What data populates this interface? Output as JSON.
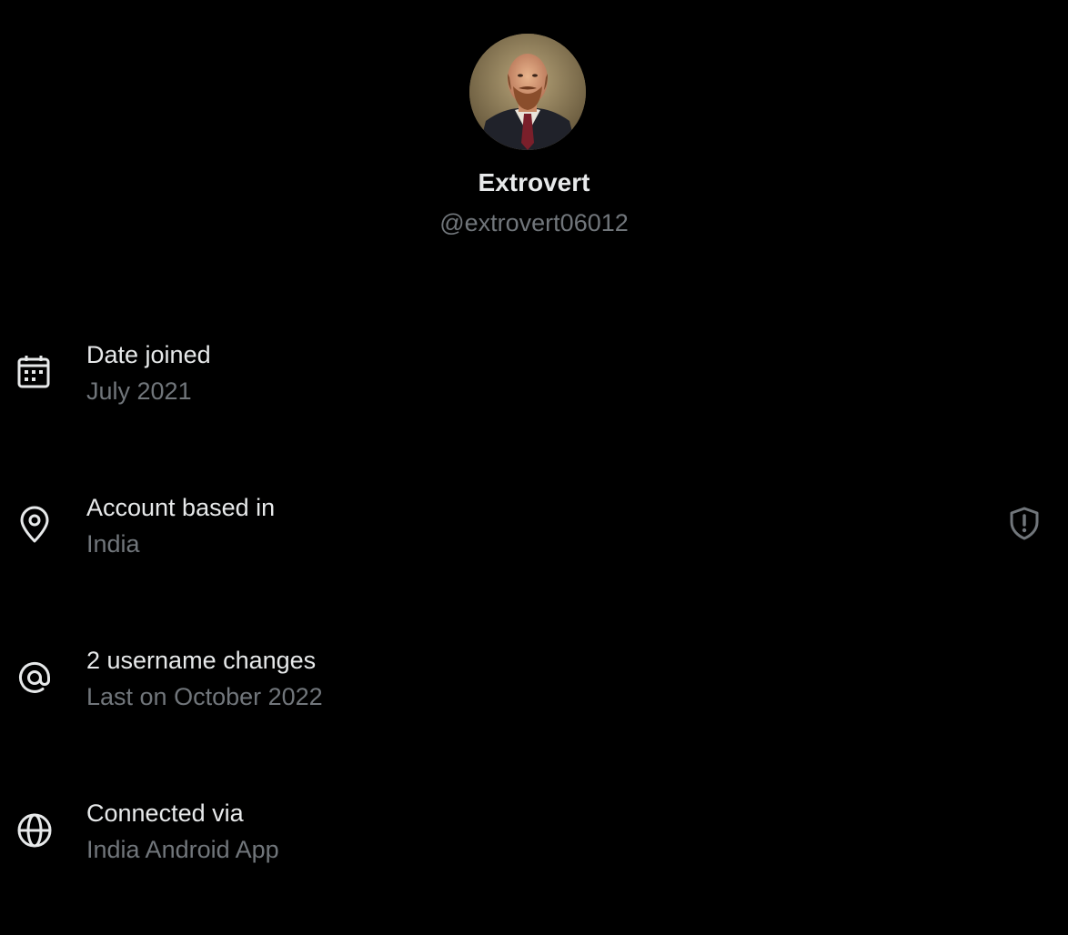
{
  "profile": {
    "display_name": "Extrovert",
    "handle": "@extrovert06012",
    "avatar_icon": "avatar-portrait"
  },
  "info_rows": [
    {
      "icon": "calendar-icon",
      "title": "Date joined",
      "value": "July 2021"
    },
    {
      "icon": "location-pin-icon",
      "title": "Account based in",
      "value": "India",
      "trailing_icon": "shield-alert-icon"
    },
    {
      "icon": "at-sign-icon",
      "title": "2 username changes",
      "value": "Last on October 2022"
    },
    {
      "icon": "globe-icon",
      "title": "Connected via",
      "value": "India Android App"
    }
  ],
  "colors": {
    "background": "#000000",
    "primary_text": "#e7e9ea",
    "secondary_text": "#71767b"
  }
}
